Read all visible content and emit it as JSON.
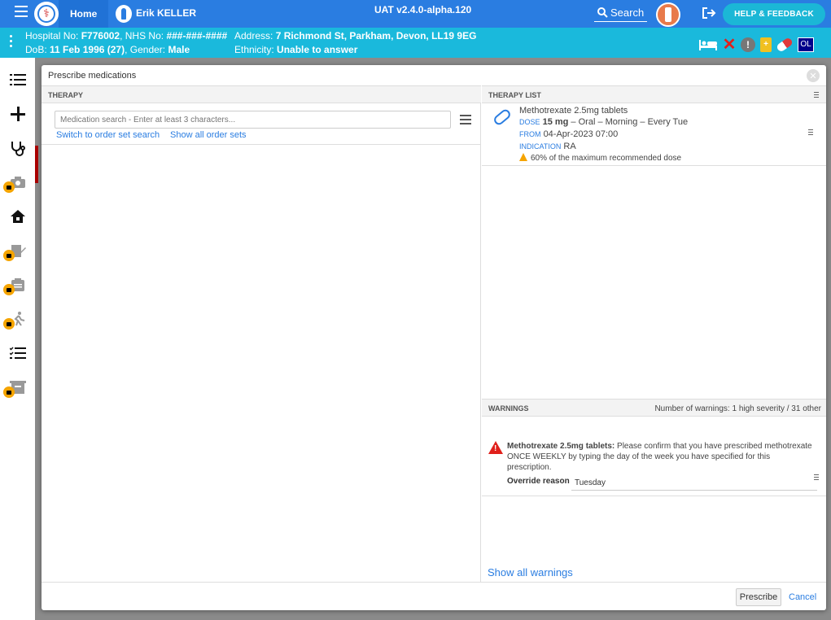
{
  "topbar": {
    "home_label": "Home",
    "patient_name": "Erik KELLER",
    "version": "UAT v2.4.0-alpha.120",
    "search_label": "Search",
    "help_label": "HELP & FEEDBACK",
    "color": "#2a7de1"
  },
  "banner": {
    "hospital_label": "Hospital No:",
    "hospital_no": "F776002",
    "nhs_label": ", NHS No:",
    "nhs_no": "###-###-####",
    "address_label": "Address:",
    "address": "7 Richmond St, Parkham, Devon, LL19 9EG",
    "dob_label": "DoB:",
    "dob": "11 Feb 1996 (27)",
    "gender_label": ", Gender:",
    "gender": "Male",
    "ethnicity_label": "Ethnicity:",
    "ethnicity": "Unable to answer",
    "ol": "OL",
    "color": "#1ab9dc"
  },
  "nav": {
    "items": [
      "list-icon",
      "plus-icon",
      "stethoscope-icon",
      "camera-icon",
      "house-icon",
      "edit-icon",
      "clipboard-icon",
      "walking-icon",
      "checklist-icon",
      "inbox-icon"
    ]
  },
  "modal": {
    "title": "Prescribe medications",
    "therapy_header": "THERAPY",
    "search_placeholder": "Medication search - Enter at least 3 characters...",
    "switch_link": "Switch to order set search",
    "show_sets_link": "Show all order sets",
    "therapy_list_header": "THERAPY LIST",
    "medication": {
      "name": "Methotrexate 2.5mg tablets",
      "dose_label": "DOSE",
      "dose_value": "15 mg",
      "dose_rest": " – Oral – Morning – Every Tue",
      "from_label": "FROM",
      "from_value": "04-Apr-2023 07:00",
      "indication_label": "INDICATION",
      "indication_value": "RA",
      "warning": "60% of the maximum recommended dose"
    },
    "warnings_header": "WARNINGS",
    "warnings_count": "Number of warnings: 1 high severity / 31 other",
    "warning_title": "Methotrexate 2.5mg tablets:",
    "warning_text": " Please confirm that you have prescribed methotrexate ONCE WEEKLY by typing the day of the week you have specified for this prescription.",
    "override_label": "Override reason",
    "override_value": "Tuesday",
    "show_all_warnings": "Show all warnings",
    "prescribe_label": "Prescribe",
    "cancel_label": "Cancel"
  }
}
